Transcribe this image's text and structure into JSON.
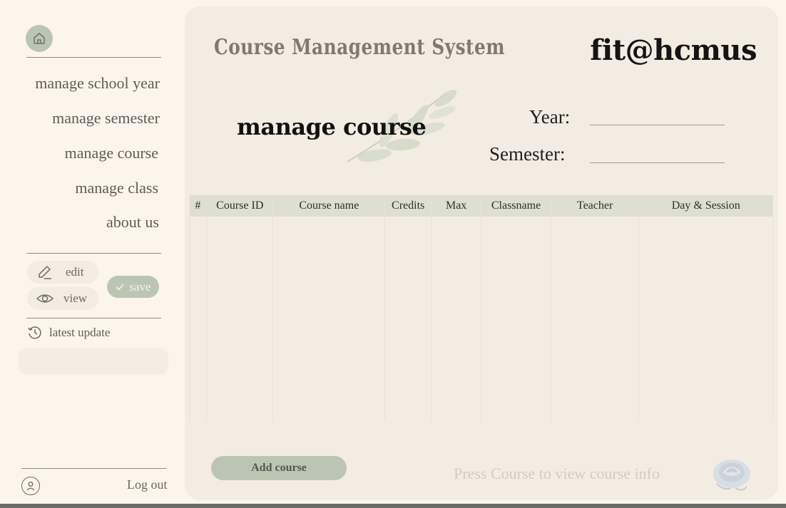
{
  "sidebar": {
    "nav": [
      {
        "label": "manage school year"
      },
      {
        "label": "manage semester"
      },
      {
        "label": "manage course"
      },
      {
        "label": "manage class"
      },
      {
        "label": "about us"
      }
    ],
    "edit_label": "edit",
    "view_label": "view",
    "save_label": "save",
    "latest_update_label": "latest update",
    "logout_label": "Log out"
  },
  "header": {
    "title": "Course Management System",
    "brand": "fit@hcmus"
  },
  "main": {
    "section_title": "manage course",
    "year_label": "Year:",
    "year_value": "",
    "semester_label": "Semester:",
    "semester_value": "",
    "table": {
      "columns": [
        "#",
        "Course ID",
        "Course name",
        "Credits",
        "Max",
        "Classname",
        "Teacher",
        "Day & Session"
      ],
      "rows": []
    },
    "add_button_label": "Add course",
    "hint": "Press Course to view course info"
  },
  "colors": {
    "background": "#fcf5ec",
    "panel": "#f3ece2",
    "accent_sage": "#bcc5b2",
    "table_header": "#dedfd0"
  }
}
